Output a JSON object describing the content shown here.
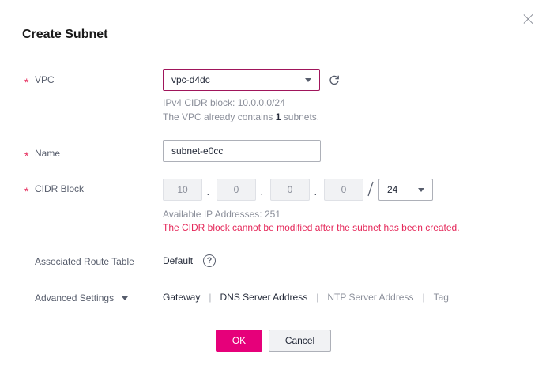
{
  "dialog": {
    "title": "Create Subnet"
  },
  "vpc": {
    "label": "VPC",
    "selected": "vpc-d4dc",
    "hint_cidr": "IPv4 CIDR block: 10.0.0.0/24",
    "hint_count_prefix": "The VPC already contains ",
    "hint_count_value": "1",
    "hint_count_suffix": " subnets."
  },
  "name": {
    "label": "Name",
    "value": "subnet-e0cc"
  },
  "cidr": {
    "label": "CIDR Block",
    "octets": [
      "10",
      "0",
      "0",
      "0"
    ],
    "separator": "·",
    "mask": "24",
    "available": "Available IP Addresses: 251",
    "warning": "The CIDR block cannot be modified after the subnet has been created."
  },
  "route_table": {
    "label": "Associated Route Table",
    "value": "Default",
    "help": "?"
  },
  "advanced": {
    "label": "Advanced Settings",
    "items": [
      "Gateway",
      "DNS Server Address",
      "NTP Server Address",
      "Tag"
    ],
    "separator": "|"
  },
  "buttons": {
    "ok": "OK",
    "cancel": "Cancel"
  },
  "required_mark": "*",
  "colors": {
    "primary": "#e6007a",
    "warning": "#e5285a",
    "focused_border": "#a0155b"
  }
}
